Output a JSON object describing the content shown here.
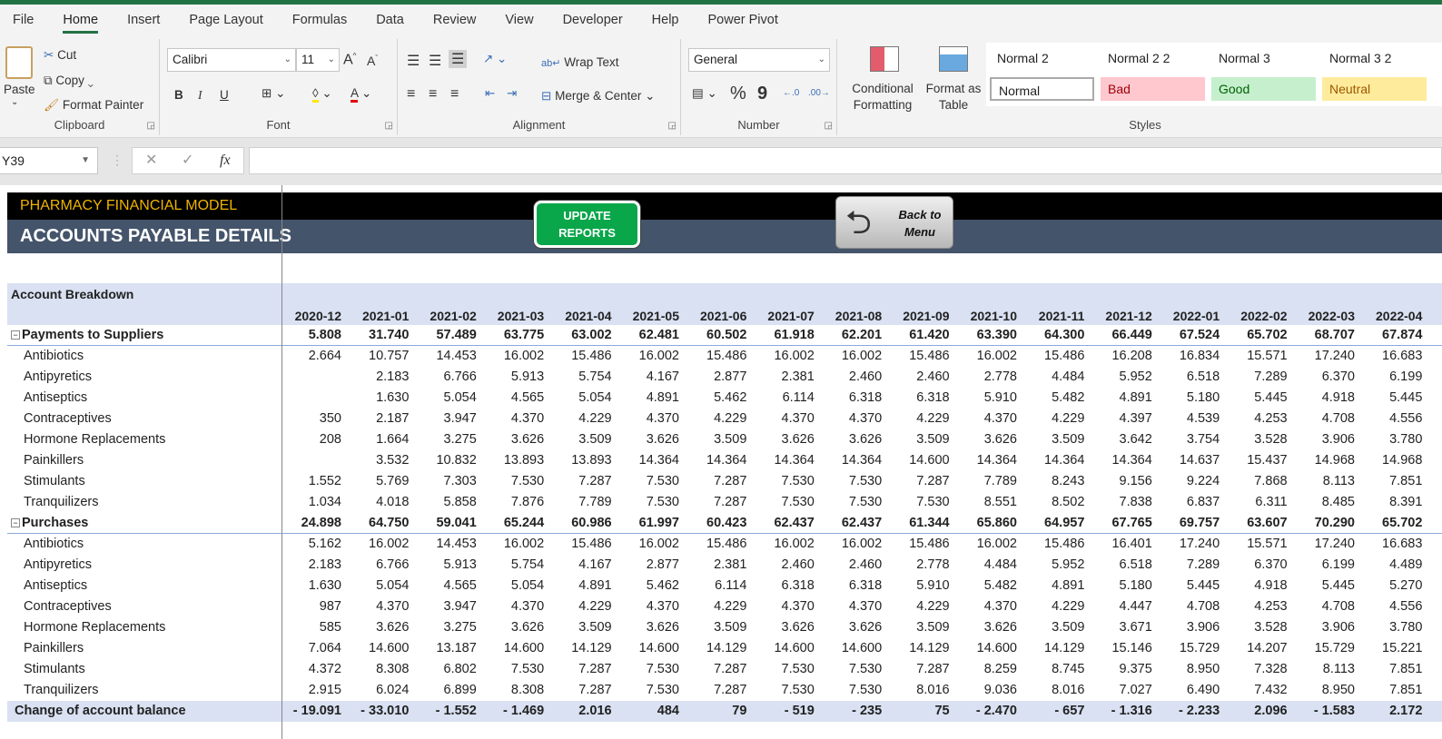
{
  "ribbon_tabs": [
    "File",
    "Home",
    "Insert",
    "Page Layout",
    "Formulas",
    "Data",
    "Review",
    "View",
    "Developer",
    "Help",
    "Power Pivot"
  ],
  "active_tab": "Home",
  "clipboard": {
    "paste": "Paste",
    "cut": "Cut",
    "copy": "Copy",
    "format_painter": "Format Painter",
    "label": "Clipboard"
  },
  "font": {
    "name": "Calibri",
    "size": "11",
    "label": "Font",
    "bold": "B",
    "italic": "I",
    "underline": "U",
    "font_color": "A",
    "grow": "A^",
    "shrink": "Aˇ"
  },
  "alignment": {
    "wrap": "Wrap Text",
    "merge": "Merge & Center",
    "label": "Alignment"
  },
  "number": {
    "format": "General",
    "percent": "%",
    "comma": "9",
    "label": "Number"
  },
  "styles": {
    "conditional": "Conditional Formatting",
    "format_table": "Format as Table",
    "label": "Styles",
    "cells": [
      {
        "name": "Normal 2"
      },
      {
        "name": "Normal 2 2"
      },
      {
        "name": "Normal 3"
      },
      {
        "name": "Normal 3 2"
      }
    ],
    "boxes": [
      {
        "name": "Normal",
        "bg": "#ffffff",
        "fg": "#222222"
      },
      {
        "name": "Bad",
        "bg": "#ffc7ce",
        "fg": "#9c0006"
      },
      {
        "name": "Good",
        "bg": "#c6efce",
        "fg": "#006100"
      },
      {
        "name": "Neutral",
        "bg": "#ffeb9c",
        "fg": "#9c5700"
      }
    ]
  },
  "formula_bar": {
    "name_box": "Y39",
    "fx": "fx",
    "value": ""
  },
  "banner": {
    "title": "PHARMACY FINANCIAL MODEL",
    "subtitle": "ACCOUNTS PAYABLE DETAILS",
    "update_button": "UPDATE REPORTS",
    "back_button": "Back to Menu"
  },
  "table": {
    "header_label": "Account Breakdown",
    "columns": [
      "2020-12",
      "2021-01",
      "2021-02",
      "2021-03",
      "2021-04",
      "2021-05",
      "2021-06",
      "2021-07",
      "2021-08",
      "2021-09",
      "2021-10",
      "2021-11",
      "2021-12",
      "2022-01",
      "2022-02",
      "2022-03",
      "2022-04"
    ],
    "rows": [
      {
        "type": "sec",
        "label": "Payments to Suppliers",
        "values": [
          "5.808",
          "31.740",
          "57.489",
          "63.775",
          "63.002",
          "62.481",
          "60.502",
          "61.918",
          "62.201",
          "61.420",
          "63.390",
          "64.300",
          "66.449",
          "67.524",
          "65.702",
          "68.707",
          "67.874"
        ]
      },
      {
        "type": "item",
        "label": "Antibiotics",
        "values": [
          "2.664",
          "10.757",
          "14.453",
          "16.002",
          "15.486",
          "16.002",
          "15.486",
          "16.002",
          "16.002",
          "15.486",
          "16.002",
          "15.486",
          "16.208",
          "16.834",
          "15.571",
          "17.240",
          "16.683"
        ]
      },
      {
        "type": "item",
        "label": "Antipyretics",
        "values": [
          "",
          "2.183",
          "6.766",
          "5.913",
          "5.754",
          "4.167",
          "2.877",
          "2.381",
          "2.460",
          "2.460",
          "2.778",
          "4.484",
          "5.952",
          "6.518",
          "7.289",
          "6.370",
          "6.199"
        ]
      },
      {
        "type": "item",
        "label": "Antiseptics",
        "values": [
          "",
          "1.630",
          "5.054",
          "4.565",
          "5.054",
          "4.891",
          "5.462",
          "6.114",
          "6.318",
          "6.318",
          "5.910",
          "5.482",
          "4.891",
          "5.180",
          "5.445",
          "4.918",
          "5.445"
        ]
      },
      {
        "type": "item",
        "label": "Contraceptives",
        "values": [
          "350",
          "2.187",
          "3.947",
          "4.370",
          "4.229",
          "4.370",
          "4.229",
          "4.370",
          "4.370",
          "4.229",
          "4.370",
          "4.229",
          "4.397",
          "4.539",
          "4.253",
          "4.708",
          "4.556"
        ]
      },
      {
        "type": "item",
        "label": "Hormone Replacements",
        "values": [
          "208",
          "1.664",
          "3.275",
          "3.626",
          "3.509",
          "3.626",
          "3.509",
          "3.626",
          "3.626",
          "3.509",
          "3.626",
          "3.509",
          "3.642",
          "3.754",
          "3.528",
          "3.906",
          "3.780"
        ]
      },
      {
        "type": "item",
        "label": "Painkillers",
        "values": [
          "",
          "3.532",
          "10.832",
          "13.893",
          "13.893",
          "14.364",
          "14.364",
          "14.364",
          "14.364",
          "14.600",
          "14.364",
          "14.364",
          "14.364",
          "14.637",
          "15.437",
          "14.968",
          "14.968"
        ]
      },
      {
        "type": "item",
        "label": "Stimulants",
        "values": [
          "1.552",
          "5.769",
          "7.303",
          "7.530",
          "7.287",
          "7.530",
          "7.287",
          "7.530",
          "7.530",
          "7.287",
          "7.789",
          "8.243",
          "9.156",
          "9.224",
          "7.868",
          "8.113",
          "7.851"
        ]
      },
      {
        "type": "item",
        "label": "Tranquilizers",
        "values": [
          "1.034",
          "4.018",
          "5.858",
          "7.876",
          "7.789",
          "7.530",
          "7.287",
          "7.530",
          "7.530",
          "7.530",
          "8.551",
          "8.502",
          "7.838",
          "6.837",
          "6.311",
          "8.485",
          "8.391"
        ]
      },
      {
        "type": "sec",
        "label": "Purchases",
        "values": [
          "24.898",
          "64.750",
          "59.041",
          "65.244",
          "60.986",
          "61.997",
          "60.423",
          "62.437",
          "62.437",
          "61.344",
          "65.860",
          "64.957",
          "67.765",
          "69.757",
          "63.607",
          "70.290",
          "65.702"
        ]
      },
      {
        "type": "item",
        "label": "Antibiotics",
        "values": [
          "5.162",
          "16.002",
          "14.453",
          "16.002",
          "15.486",
          "16.002",
          "15.486",
          "16.002",
          "16.002",
          "15.486",
          "16.002",
          "15.486",
          "16.401",
          "17.240",
          "15.571",
          "17.240",
          "16.683"
        ]
      },
      {
        "type": "item",
        "label": "Antipyretics",
        "values": [
          "2.183",
          "6.766",
          "5.913",
          "5.754",
          "4.167",
          "2.877",
          "2.381",
          "2.460",
          "2.460",
          "2.778",
          "4.484",
          "5.952",
          "6.518",
          "7.289",
          "6.370",
          "6.199",
          "4.489"
        ]
      },
      {
        "type": "item",
        "label": "Antiseptics",
        "values": [
          "1.630",
          "5.054",
          "4.565",
          "5.054",
          "4.891",
          "5.462",
          "6.114",
          "6.318",
          "6.318",
          "5.910",
          "5.482",
          "4.891",
          "5.180",
          "5.445",
          "4.918",
          "5.445",
          "5.270"
        ]
      },
      {
        "type": "item",
        "label": "Contraceptives",
        "values": [
          "987",
          "4.370",
          "3.947",
          "4.370",
          "4.229",
          "4.370",
          "4.229",
          "4.370",
          "4.370",
          "4.229",
          "4.370",
          "4.229",
          "4.447",
          "4.708",
          "4.253",
          "4.708",
          "4.556"
        ]
      },
      {
        "type": "item",
        "label": "Hormone Replacements",
        "values": [
          "585",
          "3.626",
          "3.275",
          "3.626",
          "3.509",
          "3.626",
          "3.509",
          "3.626",
          "3.626",
          "3.509",
          "3.626",
          "3.509",
          "3.671",
          "3.906",
          "3.528",
          "3.906",
          "3.780"
        ]
      },
      {
        "type": "item",
        "label": "Painkillers",
        "values": [
          "7.064",
          "14.600",
          "13.187",
          "14.600",
          "14.129",
          "14.600",
          "14.129",
          "14.600",
          "14.600",
          "14.129",
          "14.600",
          "14.129",
          "15.146",
          "15.729",
          "14.207",
          "15.729",
          "15.221"
        ]
      },
      {
        "type": "item",
        "label": "Stimulants",
        "values": [
          "4.372",
          "8.308",
          "6.802",
          "7.530",
          "7.287",
          "7.530",
          "7.287",
          "7.530",
          "7.530",
          "7.287",
          "8.259",
          "8.745",
          "9.375",
          "8.950",
          "7.328",
          "8.113",
          "7.851"
        ]
      },
      {
        "type": "item",
        "label": "Tranquilizers",
        "values": [
          "2.915",
          "6.024",
          "6.899",
          "8.308",
          "7.287",
          "7.530",
          "7.287",
          "7.530",
          "7.530",
          "8.016",
          "9.036",
          "8.016",
          "7.027",
          "6.490",
          "7.432",
          "8.950",
          "7.851"
        ]
      },
      {
        "type": "total",
        "label": "Change of account balance",
        "values": [
          "- 19.091",
          "- 33.010",
          "- 1.552",
          "- 1.469",
          "2.016",
          "484",
          "79",
          "- 519",
          "- 235",
          "75",
          "- 2.470",
          "- 657",
          "- 1.316",
          "- 2.233",
          "2.096",
          "- 1.583",
          "2.172"
        ]
      }
    ]
  }
}
